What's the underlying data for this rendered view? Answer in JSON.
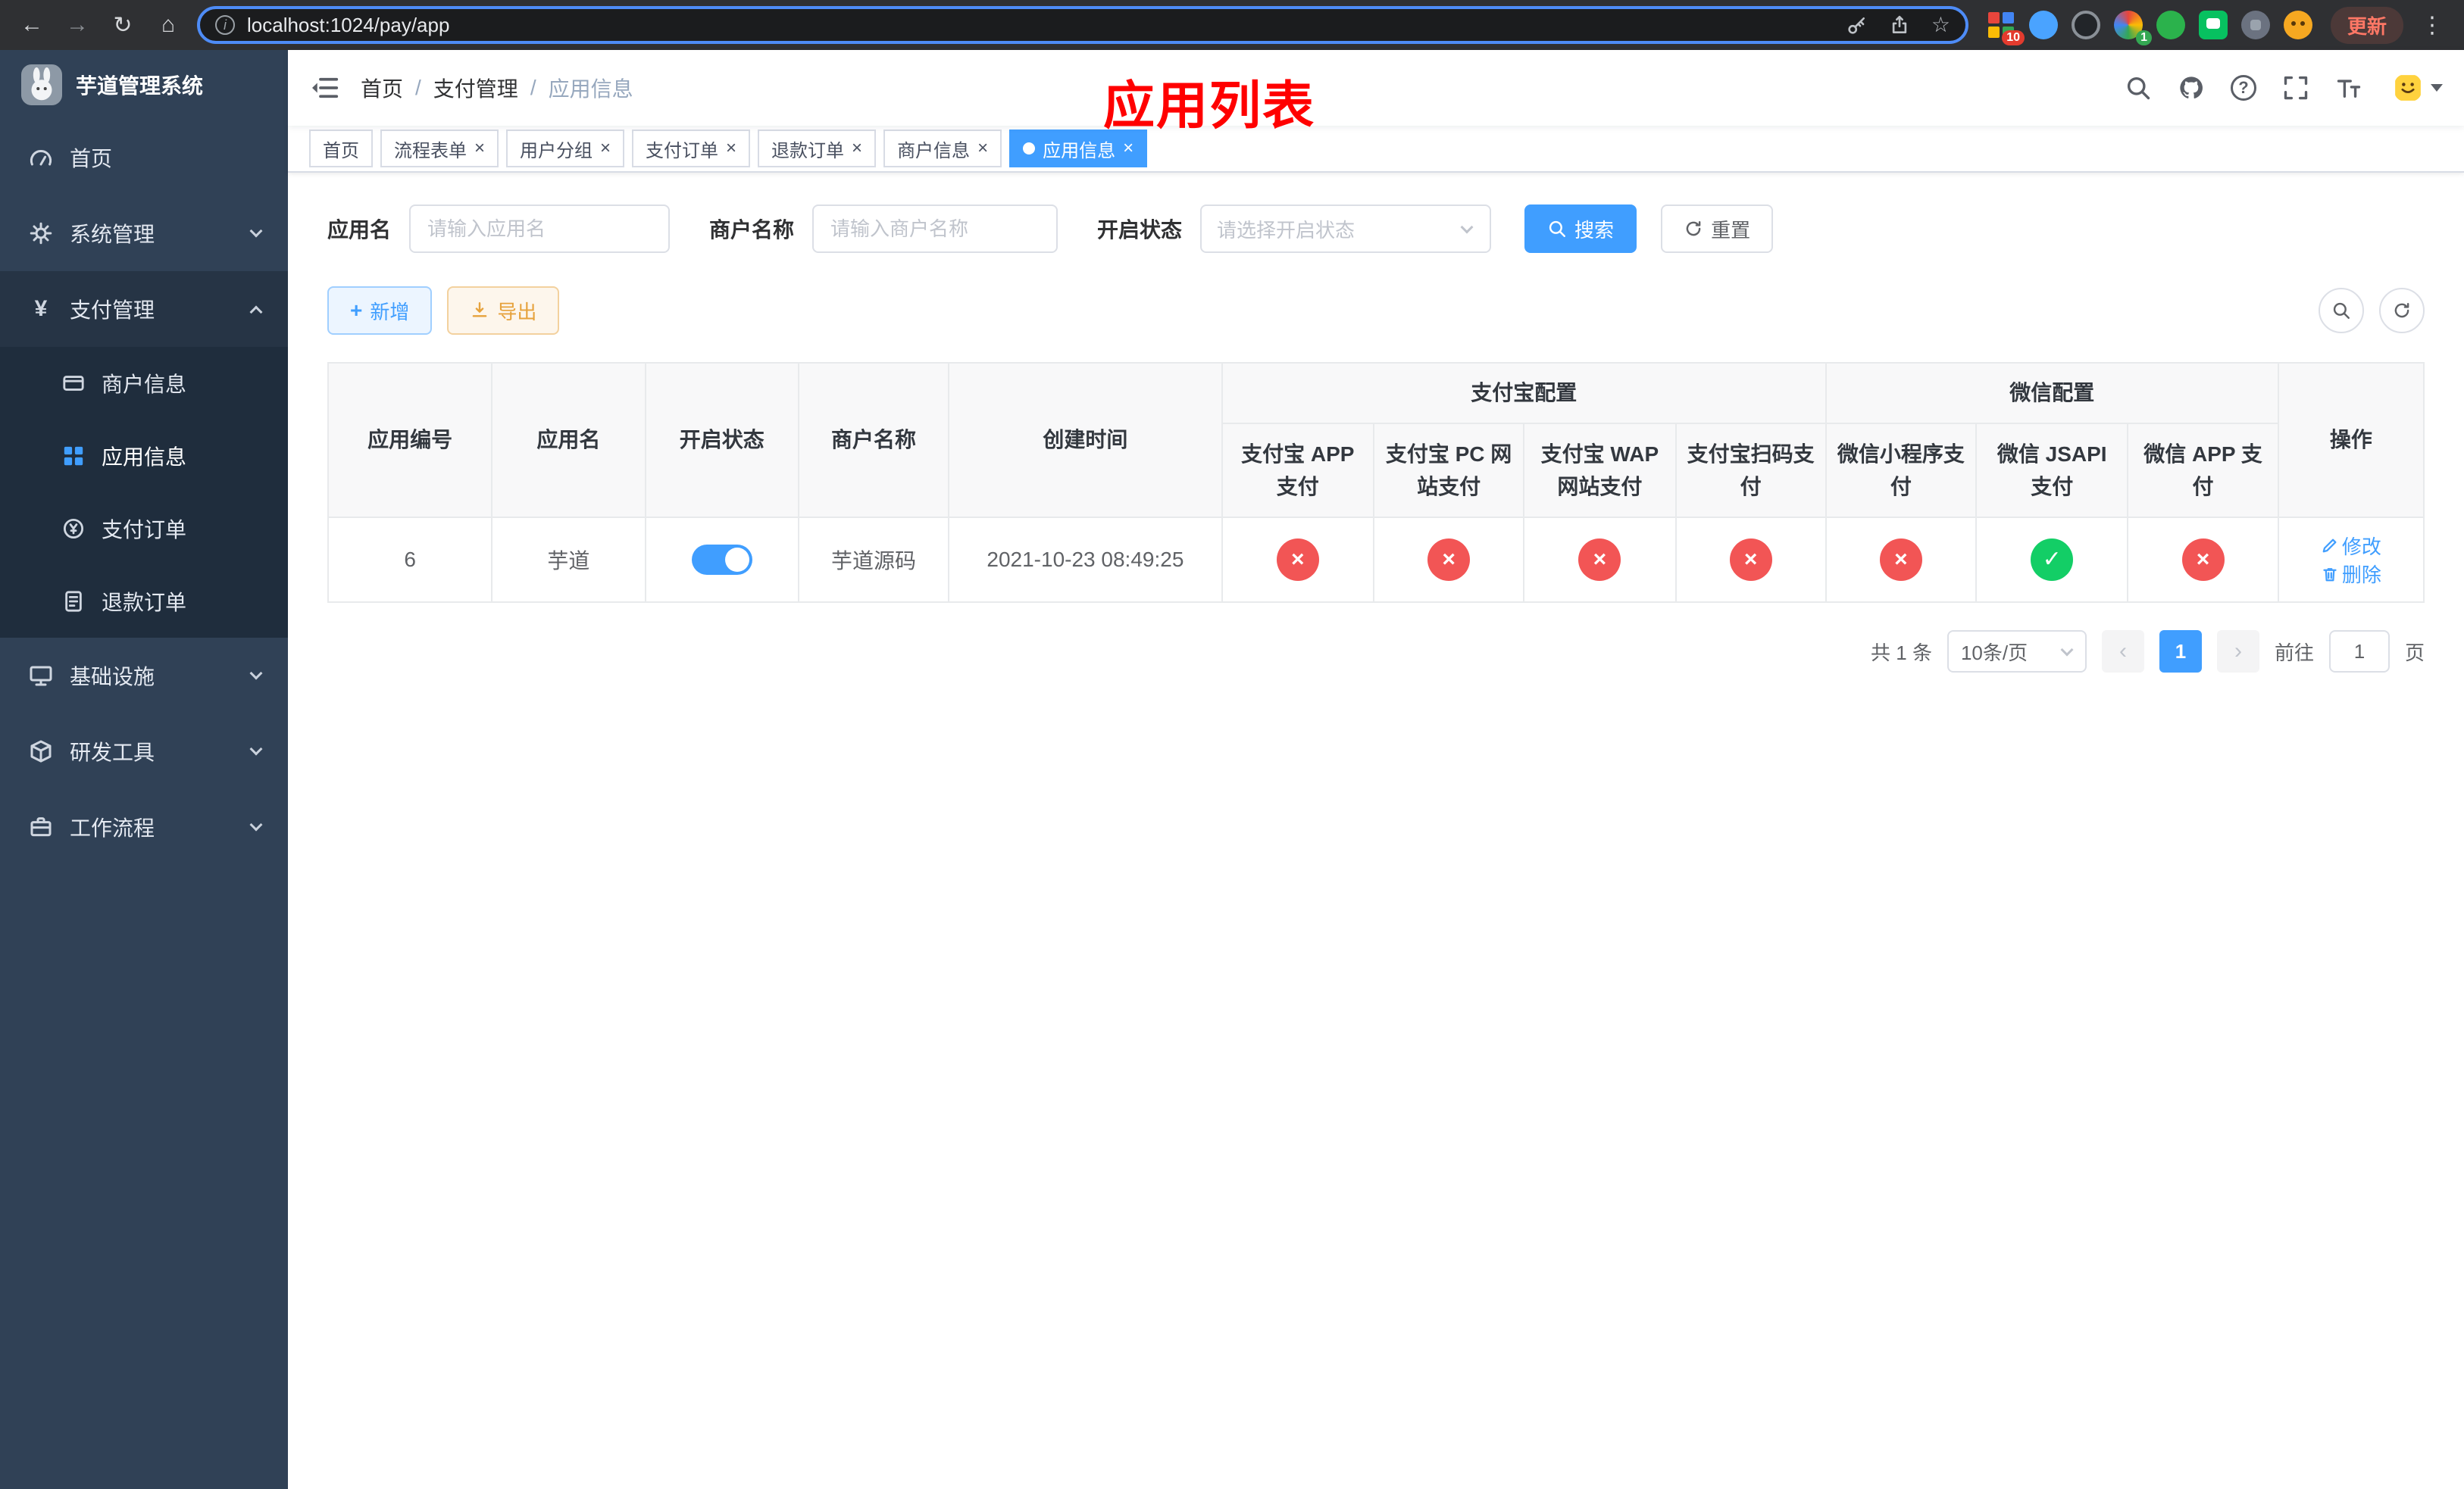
{
  "browser": {
    "url": "localhost:1024/pay/app",
    "update_label": "更新",
    "ext_badges": {
      "apps": "10",
      "profile": "1"
    }
  },
  "overlay": {
    "title": "应用列表"
  },
  "icons": {
    "back": "←",
    "forward": "→",
    "reload": "↻",
    "home": "⌂",
    "info": "i",
    "star": "☆",
    "menu_dots": "⋮",
    "yen": "¥",
    "close": "×",
    "plus": "+",
    "help": "?",
    "prev": "‹",
    "next": "›",
    "check": "✓",
    "cross": "×"
  },
  "sidebar": {
    "title": "芋道管理系统",
    "items": [
      {
        "label": "首页"
      },
      {
        "label": "系统管理"
      },
      {
        "label": "支付管理"
      },
      {
        "label": "基础设施"
      },
      {
        "label": "研发工具"
      },
      {
        "label": "工作流程"
      }
    ],
    "payment_children": [
      {
        "label": "商户信息"
      },
      {
        "label": "应用信息"
      },
      {
        "label": "支付订单"
      },
      {
        "label": "退款订单"
      }
    ]
  },
  "breadcrumb": {
    "separator": "/",
    "items": [
      {
        "label": "首页"
      },
      {
        "label": "支付管理"
      },
      {
        "label": "应用信息"
      }
    ]
  },
  "tabs": [
    {
      "label": "首页"
    },
    {
      "label": "流程表单"
    },
    {
      "label": "用户分组"
    },
    {
      "label": "支付订单"
    },
    {
      "label": "退款订单"
    },
    {
      "label": "商户信息"
    },
    {
      "label": "应用信息"
    }
  ],
  "filters": {
    "app_name_label": "应用名",
    "app_name_placeholder": "请输入应用名",
    "merchant_label": "商户名称",
    "merchant_placeholder": "请输入商户名称",
    "status_label": "开启状态",
    "status_placeholder": "请选择开启状态",
    "search_button": "搜索",
    "reset_button": "重置"
  },
  "toolbar": {
    "add": "新增",
    "export": "导出"
  },
  "table": {
    "groups": {
      "alipay": "支付宝配置",
      "wechat": "微信配置"
    },
    "columns": [
      "应用编号",
      "应用名",
      "开启状态",
      "商户名称",
      "创建时间",
      "支付宝 APP 支付",
      "支付宝 PC 网站支付",
      "支付宝 WAP 网站支付",
      "支付宝扫码支付",
      "微信小程序支付",
      "微信 JSAPI 支付",
      "微信 APP 支付",
      "操作"
    ],
    "row": {
      "id": "6",
      "name": "芋道",
      "enabled": true,
      "merchant": "芋道源码",
      "created_at": "2021-10-23 08:49:25",
      "configs": [
        {
          "name": "alipay_app",
          "enabled": false
        },
        {
          "name": "alipay_pc",
          "enabled": false
        },
        {
          "name": "alipay_wap",
          "enabled": false
        },
        {
          "name": "alipay_qr",
          "enabled": false
        },
        {
          "name": "wechat_mini",
          "enabled": false
        },
        {
          "name": "wechat_jsapi",
          "enabled": true
        },
        {
          "name": "wechat_app",
          "enabled": false
        }
      ],
      "actions": {
        "edit": "修改",
        "delete": "删除"
      }
    }
  },
  "pagination": {
    "total": "共 1 条",
    "page_size": "10条/页",
    "page": "1",
    "goto_prefix": "前往",
    "goto_value": "1",
    "goto_suffix": "页"
  },
  "colors": {
    "primary": "#409eff",
    "danger": "#f25555",
    "success": "#13ce66",
    "warning": "#e6a23c",
    "sidebar_bg": "#304156",
    "sidebar_sub_bg": "#1f2d3d",
    "overlay_title": "#ff0000"
  }
}
